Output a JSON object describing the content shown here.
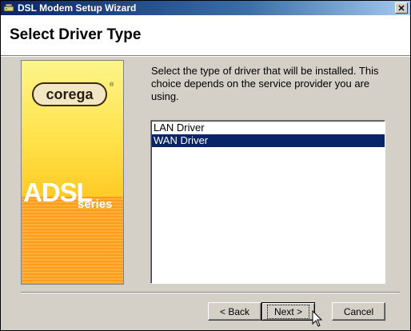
{
  "window": {
    "title": "DSL Modem Setup Wizard",
    "close_glyph": "✕"
  },
  "header": {
    "title": "Select Driver Type"
  },
  "banner": {
    "logo_text": "corega",
    "registered_mark": "®",
    "product_text": "ADSL",
    "series_text": "series"
  },
  "description": "Select the type of driver that will be installed. This choice depends on the service provider you are using.",
  "driver_list": {
    "items": [
      {
        "label": "LAN Driver",
        "selected": false
      },
      {
        "label": "WAN Driver",
        "selected": true
      }
    ]
  },
  "buttons": {
    "back": "< Back",
    "next": "Next >",
    "cancel": "Cancel"
  },
  "colors": {
    "selection": "#0a246a",
    "titlebar": "#0a246a",
    "dialog": "#d4d0c8"
  }
}
